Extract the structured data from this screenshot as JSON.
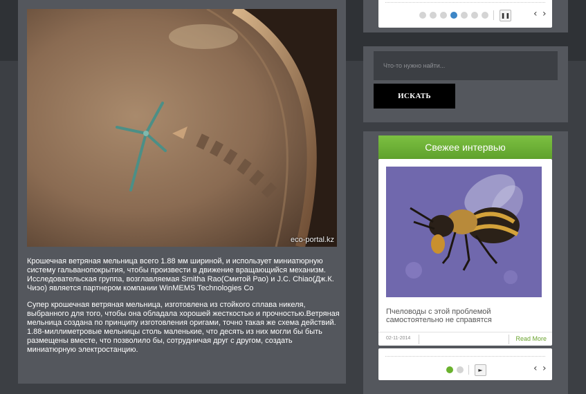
{
  "main": {
    "photo_watermark": "eco-portal.kz",
    "paragraphs": [
      "Крошечная ветряная мельница всего 1.88 мм шириной, и использует миниатюрную систему гальванопокрытия, чтобы произвести в движение вращающийся механизм. Исследовательская группа, возглавляемая Smitha Rao(Смитой Рао) и J.C. Chiao(Дж.К. Чиэо) является партнером компании WinMEMS Technologies Co",
      "Супер крошечная ветряная мельница, изготовлена из стойкого сплава никеля, выбранного для того, чтобы она обладала хорошей жесткостью и прочностью.Ветряная мельница создана по принципу изготовления оригами, точно такая же схема действий. 1.88-миллиметровые мельницы столь маленькие, что десять из них могли бы быть размещены вместе, что позволило бы, сотрудничая друг с другом, создать миниатюрную электростанцию."
    ]
  },
  "slider_top": {
    "pause_icon": "pause-icon",
    "prev_icon": "chevron-left-icon",
    "next_icon": "chevron-right-icon",
    "pause_glyph": "❚❚",
    "prev_glyph": "‹",
    "next_glyph": "›"
  },
  "search": {
    "placeholder": "Что-то нужно найти...",
    "button_label": "ИСКАТЬ"
  },
  "interview": {
    "header": "Свежее интервью",
    "title": "Пчеловоды с этой проблемой самостоятельно не справятся",
    "date": "02-11-2014",
    "read_more": "Read More",
    "play_glyph": "►",
    "prev_glyph": "‹",
    "next_glyph": "›"
  },
  "colors": {
    "accent_blue": "#3d86c6",
    "accent_green": "#6ab22e",
    "panel": "#54575d",
    "background": "#3c3f44"
  }
}
